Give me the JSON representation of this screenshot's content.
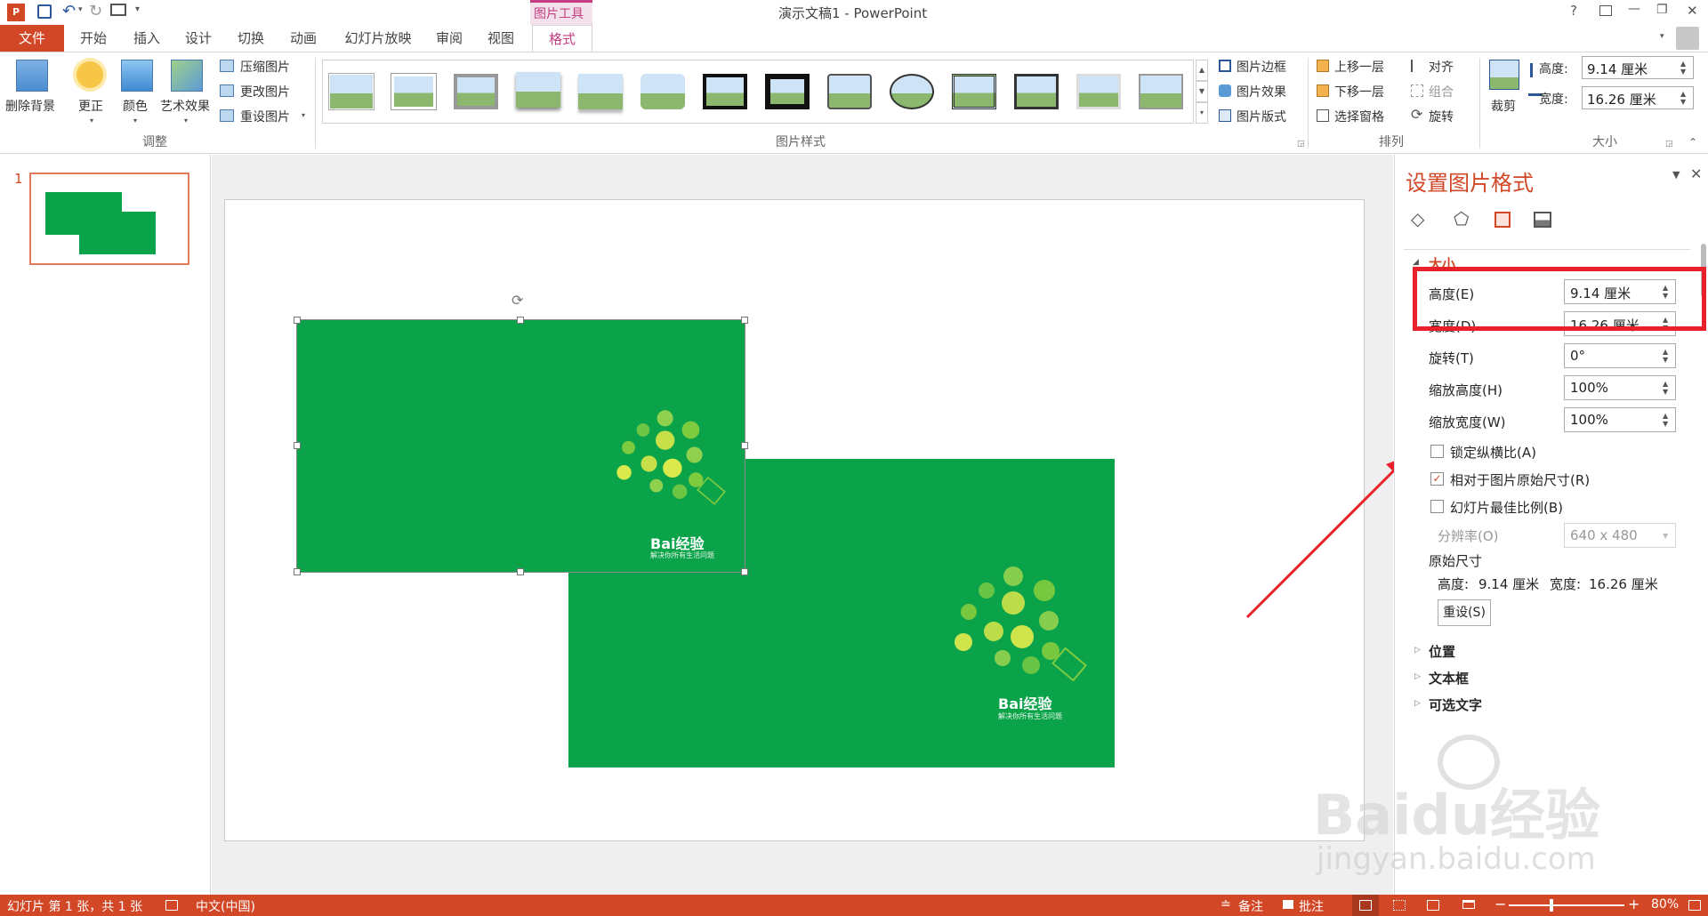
{
  "window": {
    "title": "演示文稿1 - PowerPoint",
    "contextual_group": "图片工具",
    "help": "?",
    "minimize": "—",
    "restore": "❐",
    "close": "✕"
  },
  "tabs": {
    "file": "文件",
    "home": "开始",
    "insert": "插入",
    "design": "设计",
    "transitions": "切换",
    "animations": "动画",
    "slideshow": "幻灯片放映",
    "review": "审阅",
    "view": "视图",
    "format": "格式"
  },
  "ribbon": {
    "remove_bg": "删除背景",
    "corrections": "更正",
    "color": "颜色",
    "artistic": "艺术效果",
    "compress": "压缩图片",
    "change_pic": "更改图片",
    "reset_pic": "重设图片",
    "group_adjust": "调整",
    "group_styles": "图片样式",
    "pic_border": "图片边框",
    "pic_effects": "图片效果",
    "pic_layout": "图片版式",
    "bring_forward": "上移一层",
    "send_backward": "下移一层",
    "selection_pane": "选择窗格",
    "group_arrange": "排列",
    "align": "对齐",
    "group_btn": "组合",
    "rotate": "旋转",
    "crop": "裁剪",
    "height_label": "高度:",
    "height_value": "9.14 厘米",
    "width_label": "宽度:",
    "width_value": "16.26 厘米",
    "group_size": "大小"
  },
  "slides": {
    "number": "1"
  },
  "pane": {
    "title": "设置图片格式",
    "section_size": "大小",
    "height_label": "高度(E)",
    "height_value": "9.14 厘米",
    "width_label": "宽度(D)",
    "width_value": "16.26 厘米",
    "rotation_label": "旋转(T)",
    "rotation_value": "0°",
    "scale_h_label": "缩放高度(H)",
    "scale_h_value": "100%",
    "scale_w_label": "缩放宽度(W)",
    "scale_w_value": "100%",
    "lock_ratio": "锁定纵横比(A)",
    "lock_ratio_checked": false,
    "relative_original": "相对于图片原始尺寸(R)",
    "relative_original_checked": true,
    "best_scale": "幻灯片最佳比例(B)",
    "best_scale_checked": false,
    "resolution_label": "分辨率(O)",
    "resolution_value": "640 x 480",
    "original_size": "原始尺寸",
    "orig_h_label": "高度:",
    "orig_h_value": "9.14 厘米",
    "orig_w_label": "宽度:",
    "orig_w_value": "16.26 厘米",
    "reset_button": "重设(S)",
    "position": "位置",
    "textbox": "文本框",
    "alt_text": "可选文字"
  },
  "image_brand": {
    "logo": "Bai经验",
    "slogan": "解决你所有生活问题"
  },
  "watermark": {
    "logo": "Baidu经验",
    "url": "jingyan.baidu.com"
  },
  "statusbar": {
    "slide_info": "幻灯片 第 1 张，共 1 张",
    "language": "中文(中国)",
    "notes": "备注",
    "comments": "批注",
    "zoom": "80%"
  },
  "colors": {
    "accent": "#d24726",
    "image_green": "#0aa34a",
    "highlight_red": "#e8202a",
    "tab_context": "#c43e81"
  }
}
